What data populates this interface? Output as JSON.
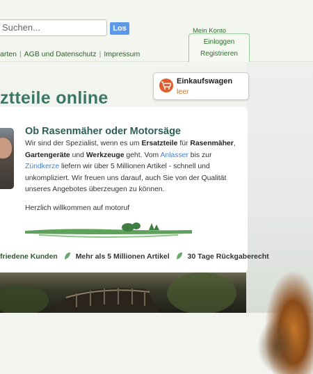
{
  "header": {
    "search": {
      "placeholder": "Suchen..."
    },
    "search_button": "Los",
    "links": [
      "arten",
      "AGB und Datenschutz",
      "Impressum"
    ],
    "account": {
      "label": "Mein Konto",
      "login": "Einloggen",
      "register": "Registrieren"
    }
  },
  "cart": {
    "title": "Einkaufswagen",
    "status": "leer",
    "icon": "shopping-cart-icon",
    "icon_color": "#df5d2e"
  },
  "hero": {
    "title": "ztteile online"
  },
  "intro": {
    "title": "Ob Rasenmäher oder Motorsäge",
    "p1": "Wir sind der Spezialist, wenn es um ",
    "b1": "Ersatzteile",
    "p2": " für ",
    "b2": "Rasenmäher",
    "p3": ",",
    "b3": "Gartengeräte",
    "p4": " und ",
    "b4": "Werkzeuge",
    "p5": " geht. Vom ",
    "link1": "Anlasser",
    "p6": " bis zur",
    "link2": "Zündkerze",
    "p7": " liefern wir über 5 Millionen Artikel - schnell und unkompliziert. Wir freuen uns darauf, auch Sie von der Qualität unseres Angebotes überzeugen zu können.",
    "welcome": "Herzlich willkommen auf motoruf"
  },
  "features": [
    "friedene Kunden",
    "Mehr als 5 Millionen Artikel",
    "30 Tage Rückgaberecht"
  ],
  "colors": {
    "accent": "#5d99e6",
    "brand_green": "#3c7766",
    "link_blue": "#3f7fd0"
  }
}
